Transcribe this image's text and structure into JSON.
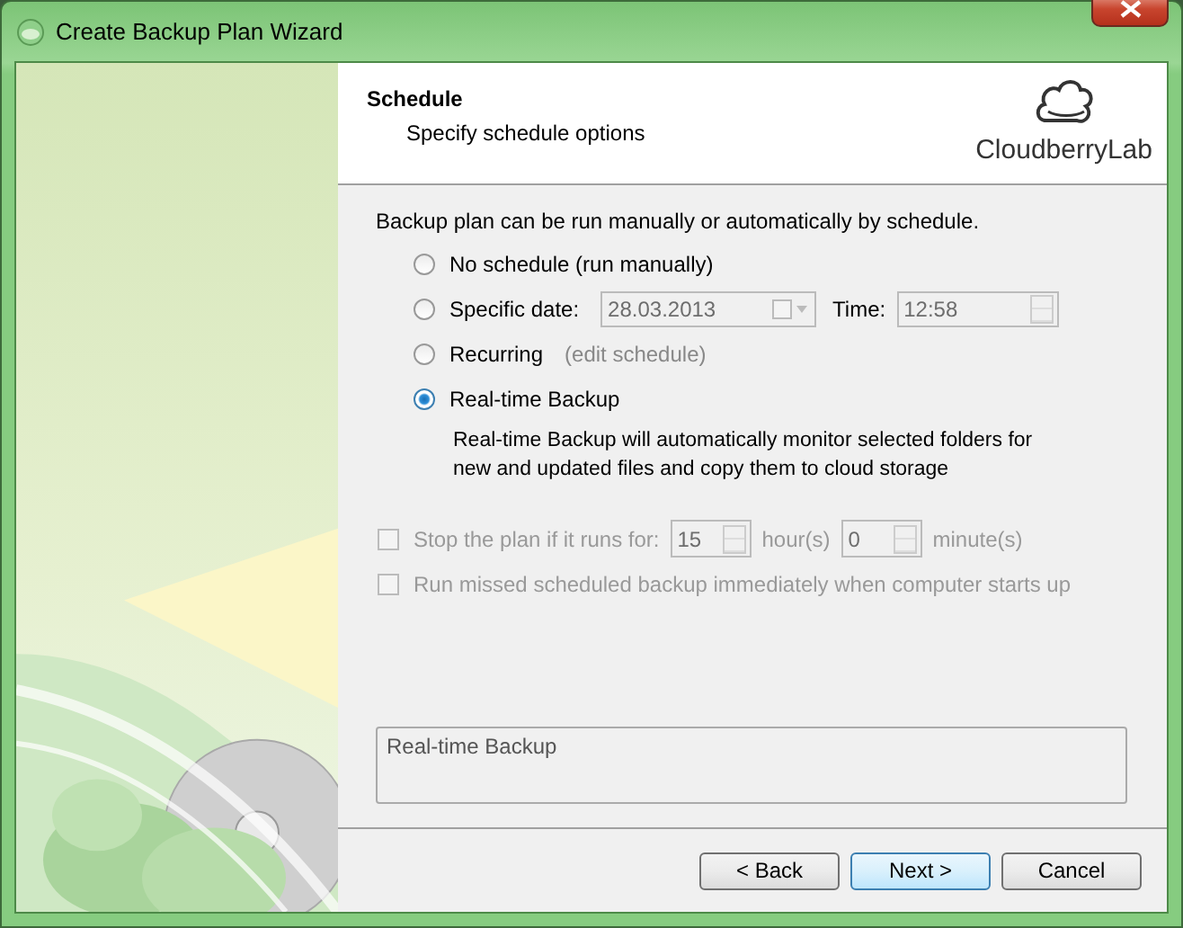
{
  "window": {
    "title": "Create Backup Plan Wizard"
  },
  "header": {
    "title": "Schedule",
    "subtitle": "Specify schedule options",
    "logo": "CloudberryLab"
  },
  "intro": "Backup plan can be run manually or automatically by schedule.",
  "options": [
    {
      "label": "No schedule (run manually)",
      "selected": false
    },
    {
      "label": "Specific date:",
      "selected": false,
      "date": "28.03.2013",
      "time_label": "Time:",
      "time": "12:58"
    },
    {
      "label": "Recurring",
      "selected": false,
      "link": "(edit schedule)"
    },
    {
      "label": "Real-time Backup",
      "selected": true,
      "description": "Real-time Backup will automatically monitor selected folders for new and updated files and copy them to cloud storage"
    }
  ],
  "stop_plan": {
    "label": "Stop the plan if it runs for:",
    "checked": false,
    "disabled": true,
    "hours": "15",
    "hours_label": "hour(s)",
    "minutes": "0",
    "minutes_label": "minute(s)"
  },
  "run_missed": {
    "label": "Run missed scheduled backup immediately when computer starts up",
    "checked": false,
    "disabled": true
  },
  "summary": "Real-time Backup",
  "buttons": [
    "< Back",
    "Next >",
    "Cancel"
  ]
}
